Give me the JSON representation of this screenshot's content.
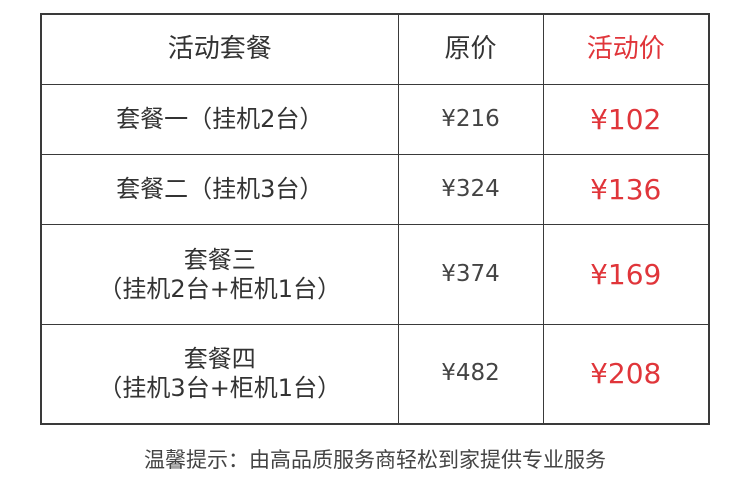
{
  "table": {
    "headers": {
      "name": "活动套餐",
      "original": "原价",
      "promo": "活动价"
    },
    "rows": [
      {
        "name_lines": [
          "套餐一（挂机2台）"
        ],
        "original": "¥216",
        "promo": "¥102"
      },
      {
        "name_lines": [
          "套餐二（挂机3台）"
        ],
        "original": "¥324",
        "promo": "¥136"
      },
      {
        "name_lines": [
          "套餐三",
          "（挂机2台+柜机1台）"
        ],
        "original": "¥374",
        "promo": "¥169"
      },
      {
        "name_lines": [
          "套餐四",
          "（挂机3台+柜机1台）"
        ],
        "original": "¥482",
        "promo": "¥208"
      }
    ]
  },
  "footnote": "温馨提示：由高品质服务商轻松到家提供专业服务",
  "colors": {
    "accent": "#e0353a",
    "text": "#333333",
    "border": "#3a3a3a"
  }
}
